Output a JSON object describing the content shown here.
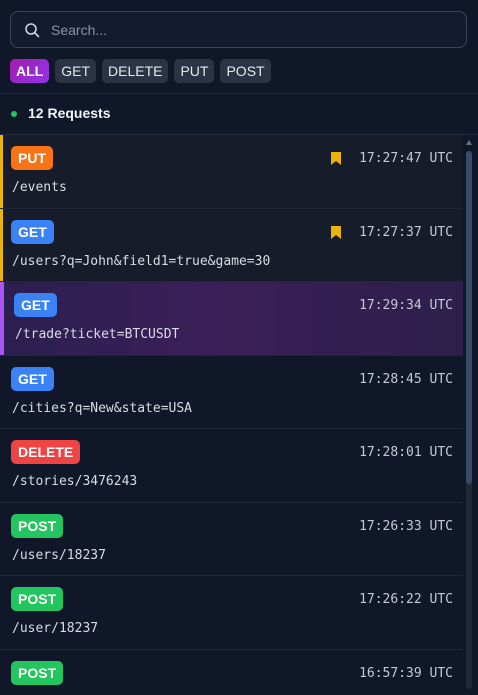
{
  "search": {
    "placeholder": "Search..."
  },
  "filters": [
    "ALL",
    "GET",
    "DELETE",
    "PUT",
    "POST"
  ],
  "active_filter": "ALL",
  "request_count_label": "12 Requests",
  "colors": {
    "get": "#3b82f6",
    "put": "#f97316",
    "delete": "#ef4444",
    "post": "#22c55e",
    "bookmark": "#eab308",
    "selected": "#a855f7",
    "active_filter": "#a21caf"
  },
  "requests": [
    {
      "method": "PUT",
      "path": "/events",
      "time": "17:27:47 UTC",
      "bookmarked": true,
      "selected": false
    },
    {
      "method": "GET",
      "path": "/users?q=John&field1=true&game=30",
      "time": "17:27:37 UTC",
      "bookmarked": true,
      "selected": false
    },
    {
      "method": "GET",
      "path": "/trade?ticket=BTCUSDT",
      "time": "17:29:34 UTC",
      "bookmarked": false,
      "selected": true
    },
    {
      "method": "GET",
      "path": "/cities?q=New&state=USA",
      "time": "17:28:45 UTC",
      "bookmarked": false,
      "selected": false
    },
    {
      "method": "DELETE",
      "path": "/stories/3476243",
      "time": "17:28:01 UTC",
      "bookmarked": false,
      "selected": false
    },
    {
      "method": "POST",
      "path": "/users/18237",
      "time": "17:26:33 UTC",
      "bookmarked": false,
      "selected": false
    },
    {
      "method": "POST",
      "path": "/user/18237",
      "time": "17:26:22 UTC",
      "bookmarked": false,
      "selected": false
    },
    {
      "method": "POST",
      "path": "",
      "time": "16:57:39 UTC",
      "bookmarked": false,
      "selected": false
    }
  ]
}
